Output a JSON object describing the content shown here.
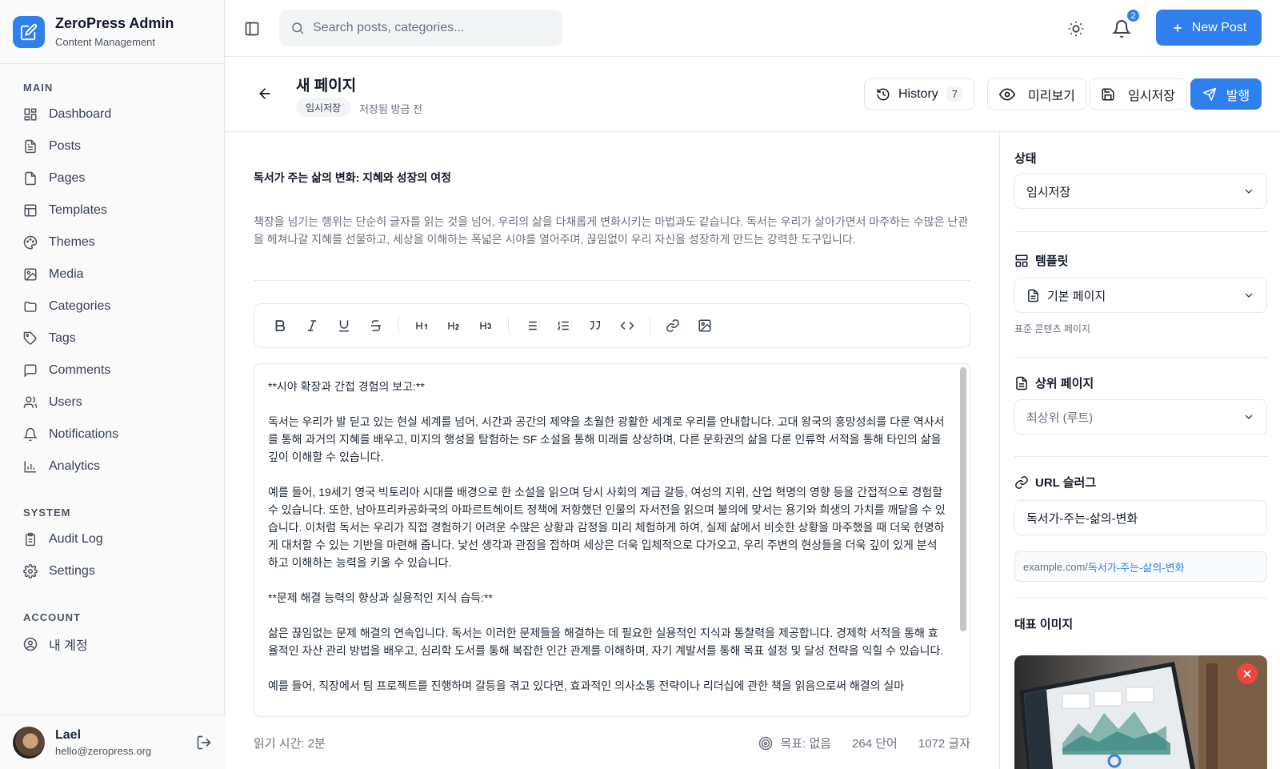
{
  "brand": {
    "title": "ZeroPress Admin",
    "subtitle": "Content Management",
    "accent": "#2f80ed"
  },
  "sidebar": {
    "sections": [
      {
        "label": "MAIN",
        "items": [
          {
            "label": "Dashboard",
            "icon": "dashboard-icon"
          },
          {
            "label": "Posts",
            "icon": "file-text-icon"
          },
          {
            "label": "Pages",
            "icon": "file-icon"
          },
          {
            "label": "Templates",
            "icon": "layout-icon"
          },
          {
            "label": "Themes",
            "icon": "palette-icon"
          },
          {
            "label": "Media",
            "icon": "image-icon"
          },
          {
            "label": "Categories",
            "icon": "folder-icon"
          },
          {
            "label": "Tags",
            "icon": "tag-icon"
          },
          {
            "label": "Comments",
            "icon": "message-icon"
          },
          {
            "label": "Users",
            "icon": "users-icon"
          },
          {
            "label": "Notifications",
            "icon": "bell-icon"
          },
          {
            "label": "Analytics",
            "icon": "bar-chart-icon"
          }
        ]
      },
      {
        "label": "SYSTEM",
        "items": [
          {
            "label": "Audit Log",
            "icon": "clipboard-icon"
          },
          {
            "label": "Settings",
            "icon": "gear-icon"
          }
        ]
      },
      {
        "label": "ACCOUNT",
        "items": [
          {
            "label": "내 계정",
            "icon": "user-circle-icon"
          }
        ]
      }
    ],
    "user": {
      "name": "Lael",
      "email": "hello@zeropress.org"
    }
  },
  "topbar": {
    "search_placeholder": "Search posts, categories...",
    "notification_count": "2",
    "new_post_label": "New Post"
  },
  "page_header": {
    "title": "새 페이지",
    "status_chip": "임시저장",
    "saved_text": "저장됨 방금 전",
    "history_label": "History",
    "history_count": "7",
    "preview_label": "미리보기",
    "save_draft_label": "임시저장",
    "publish_label": "발행"
  },
  "editor": {
    "doc_title": "독서가 주는 삶의 변화: 지혜와 성장의 여정",
    "excerpt": "책장을 넘기는 행위는 단순히 글자를 읽는 것을 넘어, 우리의 삶을 다채롭게 변화시키는 마법과도 같습니다. 독서는 우리가 살아가면서 마주하는 수많은 난관을 헤쳐나갈 지혜를 선물하고, 세상을 이해하는 폭넓은 시야를 열어주며, 끊임없이 우리 자신을 성장하게 만드는 강력한 도구입니다.",
    "toolbar": [
      "Bold",
      "Italic",
      "Underline",
      "Strikethrough",
      "H1",
      "H2",
      "H3",
      "Bullet list",
      "Numbered list",
      "Quote",
      "Code",
      "Link",
      "Image"
    ],
    "paragraphs": [
      "**시야 확장과 간접 경험의 보고:**",
      "독서는 우리가 발 딛고 있는 현실 세계를 넘어, 시간과 공간의 제약을 초월한 광활한 세계로 우리를 안내합니다. 고대 왕국의 흥망성쇠를 다룬 역사서를 통해 과거의 지혜를 배우고, 미지의 행성을 탐험하는 SF 소설을 통해 미래를 상상하며, 다른 문화권의 삶을 다룬 인류학 서적을 통해 타인의 삶을 깊이 이해할 수 있습니다.",
      "예를 들어, 19세기 영국 빅토리아 시대를 배경으로 한 소설을 읽으며 당시 사회의 계급 갈등, 여성의 지위, 산업 혁명의 영향 등을 간접적으로 경험할 수 있습니다. 또한, 남아프리카공화국의 아파르트헤이트 정책에 저항했던 인물의 자서전을 읽으며 불의에 맞서는 용기와 희생의 가치를 깨달을 수 있습니다. 이처럼 독서는 우리가 직접 경험하기 어려운 수많은 상황과 감정을 미리 체험하게 하여, 실제 삶에서 비슷한 상황을 마주했을 때 더욱 현명하게 대처할 수 있는 기반을 마련해 줍니다. 낯선 생각과 관점을 접하며 세상은 더욱 입체적으로 다가오고, 우리 주변의 현상들을 더욱 깊이 있게 분석하고 이해하는 능력을 키울 수 있습니다.",
      "**문제 해결 능력의 향상과 실용적인 지식 습득:**",
      "삶은 끊임없는 문제 해결의 연속입니다. 독서는 이러한 문제들을 해결하는 데 필요한 실용적인 지식과 통찰력을 제공합니다. 경제학 서적을 통해 효율적인 자산 관리 방법을 배우고, 심리학 도서를 통해 복잡한 인간 관계를 이해하며, 자기 계발서를 통해 목표 설정 및 달성 전략을 익힐 수 있습니다.",
      "예를 들어, 직장에서 팀 프로젝트를 진행하며 갈등을 겪고 있다면, 효과적인 의사소통 전략이나 리더십에 관한 책을 읽음으로써 해결의 실마"
    ],
    "reading_time": "읽기 시간: 2분",
    "goal": "목표: 없음",
    "word_count": "264 단어",
    "char_count": "1072 글자"
  },
  "panel": {
    "status_label": "상태",
    "status_value": "임시저장",
    "template_label": "템플릿",
    "template_value": "기본 페이지",
    "template_help": "표준 콘텐츠 페이지",
    "parent_label": "상위 페이지",
    "parent_value": "최상위 (루트)",
    "slug_label": "URL 슬러그",
    "slug_value": "독서가-주는-삶의-변화",
    "url_prefix": "example.com/",
    "url_slug": "독서가-주는-삶의-변화",
    "featured_label": "대표 이미지"
  }
}
